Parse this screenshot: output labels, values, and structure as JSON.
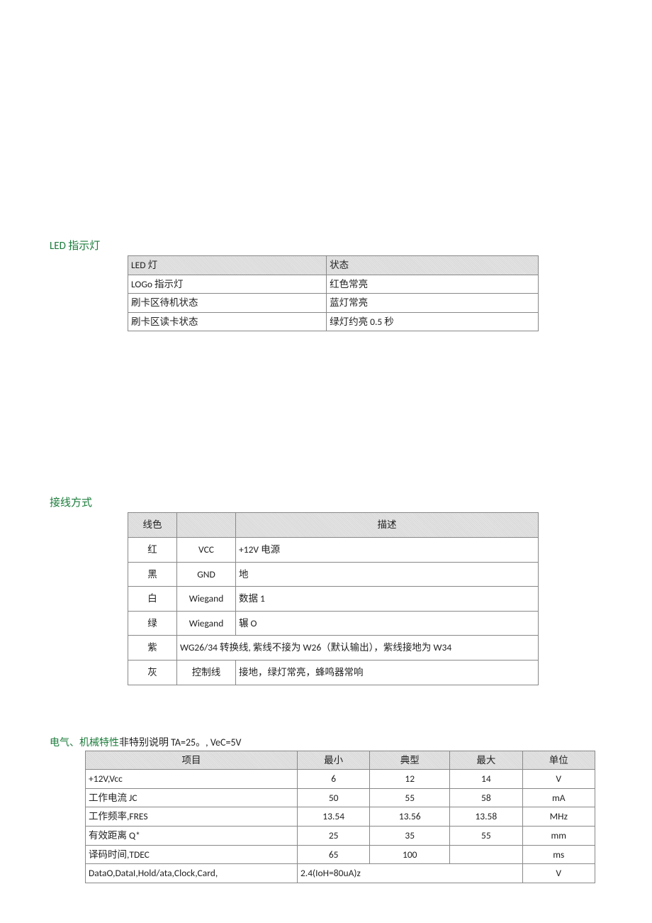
{
  "led": {
    "heading": "LED 指示灯",
    "headers": [
      "LED 灯",
      "状态"
    ],
    "rows": [
      [
        "LOGo 指示灯",
        "红色常亮"
      ],
      [
        "刷卡区待机状态",
        "蓝灯常亮"
      ],
      [
        "刷卡区读卡状态",
        "绿灯约亮 0.5 秒"
      ]
    ]
  },
  "wiring": {
    "heading": "接线方式",
    "headers": [
      "线色",
      "",
      "描述"
    ],
    "rows": [
      {
        "color": "红",
        "signal": "VCC",
        "desc": "+12V 电源"
      },
      {
        "color": "黑",
        "signal": "GND",
        "desc": "地"
      },
      {
        "color": "白",
        "signal": "Wiegand",
        "desc": "数据 1"
      },
      {
        "color": "绿",
        "signal": "Wiegand",
        "desc": "辗 O"
      },
      {
        "color": "紫",
        "signal_span": true,
        "desc": "WG26/34 转换线, 紫线不接为 W26（默认输出），紫线接地为 W34"
      },
      {
        "color": "灰",
        "signal": "控制线",
        "desc": "接地，绿灯常亮，蜂鸣器常响"
      }
    ]
  },
  "elec": {
    "heading_green": "电气、机械特性",
    "heading_black": "非特别说明 TA=25。, VeC=5V",
    "headers": [
      "项目",
      "最小",
      "典型",
      "最大",
      "单位"
    ],
    "rows": [
      {
        "item": "+12V,Vcc",
        "min": "6",
        "typ": "12",
        "max": "14",
        "unit": "V"
      },
      {
        "item": "工作电流 JC",
        "min": "50",
        "typ": "55",
        "max": "58",
        "unit": "mA"
      },
      {
        "item": "工作频率,FRES",
        "min": "13.54",
        "typ": "13.56",
        "max": "13.58",
        "unit": "MHz"
      },
      {
        "item": "有效距离 Q*",
        "min": "25",
        "typ": "35",
        "max": "55",
        "unit": "mm"
      },
      {
        "item": "译码时间,TDEC",
        "min": "65",
        "typ": "100",
        "max": "",
        "unit": "ms"
      },
      {
        "item": "DataO,DataI,Hold/ata,Clock,Card,",
        "min_span": "2.4(IoH=80uA)z",
        "unit": "V"
      }
    ]
  }
}
